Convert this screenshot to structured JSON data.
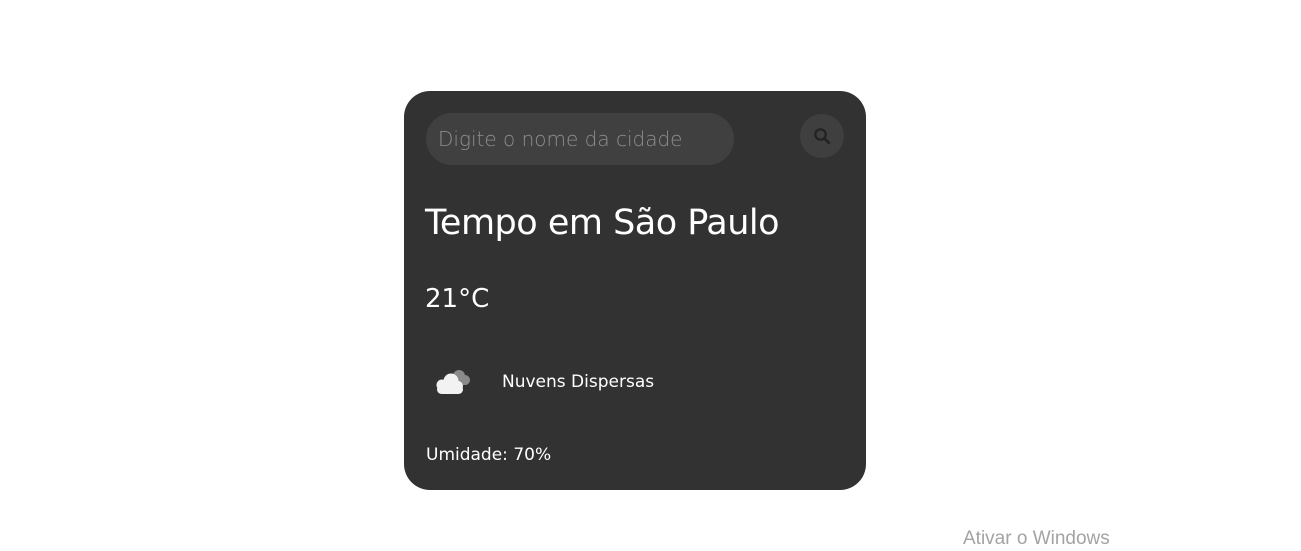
{
  "search": {
    "placeholder": "Digite o nome da cidade",
    "value": "",
    "button_icon": "search-icon"
  },
  "weather": {
    "title": "Tempo em São Paulo",
    "temperature": "21°C",
    "icon": "scattered-clouds-icon",
    "description": "Nuvens Dispersas",
    "humidity": "Umidade: 70%"
  },
  "watermark": "Ativar o Windows",
  "colors": {
    "page_background": "#ffffff",
    "card_background": "#323232",
    "input_background": "#404040",
    "text": "#ffffff",
    "placeholder": "#8e8e8e",
    "watermark": "#a3a3a3"
  }
}
